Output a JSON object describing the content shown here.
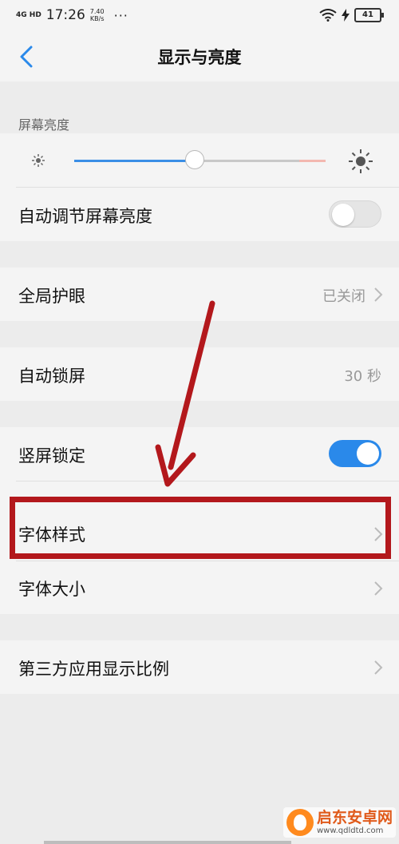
{
  "status_bar": {
    "network": "4G HD",
    "time": "17:26",
    "speed_value": "7.40",
    "speed_unit": "KB/s",
    "more": "···",
    "battery": "41"
  },
  "header": {
    "title": "显示与亮度"
  },
  "brightness": {
    "label": "屏幕亮度",
    "level_percent": 48
  },
  "auto_brightness": {
    "label": "自动调节屏幕亮度",
    "enabled": false
  },
  "eye_protection": {
    "label": "全局护眼",
    "value": "已关闭"
  },
  "auto_lock": {
    "label": "自动锁屏",
    "value": "30 秒"
  },
  "portrait_lock": {
    "label": "竖屏锁定",
    "enabled": true
  },
  "font_style": {
    "label": "字体样式"
  },
  "font_size": {
    "label": "字体大小"
  },
  "third_party_ratio": {
    "label": "第三方应用显示比例"
  },
  "watermark": {
    "name": "启东安卓网",
    "url": "www.qdldtd.com"
  },
  "colors": {
    "accent": "#2a89ea",
    "annotation": "#b3181c",
    "page_bg": "#ececec",
    "card_bg": "#f4f4f4"
  }
}
